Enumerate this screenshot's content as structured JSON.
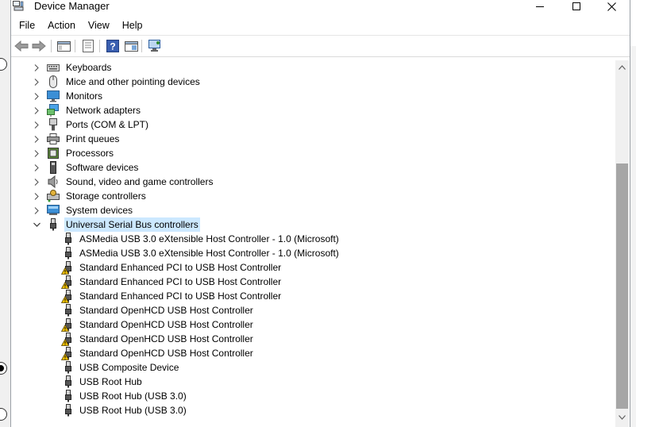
{
  "window": {
    "title": "Device Manager"
  },
  "menu": [
    "File",
    "Action",
    "View",
    "Help"
  ],
  "toolbar": [
    "back-icon",
    "forward-icon",
    "show-hide-console-tree-icon",
    "properties-icon",
    "help-icon",
    "update-driver-icon",
    "scan-hardware-icon"
  ],
  "categories": [
    {
      "label": "Keyboards",
      "icon": "keyboard-icon",
      "expanded": false
    },
    {
      "label": "Mice and other pointing devices",
      "icon": "mouse-icon",
      "expanded": false
    },
    {
      "label": "Monitors",
      "icon": "monitor-icon",
      "expanded": false
    },
    {
      "label": "Network adapters",
      "icon": "network-adapter-icon",
      "expanded": false
    },
    {
      "label": "Ports (COM & LPT)",
      "icon": "port-icon",
      "expanded": false
    },
    {
      "label": "Print queues",
      "icon": "printer-icon",
      "expanded": false
    },
    {
      "label": "Processors",
      "icon": "processor-icon",
      "expanded": false
    },
    {
      "label": "Software devices",
      "icon": "software-device-icon",
      "expanded": false
    },
    {
      "label": "Sound, video and game controllers",
      "icon": "speaker-icon",
      "expanded": false
    },
    {
      "label": "Storage controllers",
      "icon": "storage-controller-icon",
      "expanded": false
    },
    {
      "label": "System devices",
      "icon": "system-device-icon",
      "expanded": false
    },
    {
      "label": "Universal Serial Bus controllers",
      "icon": "usb-icon",
      "expanded": true,
      "selected": true
    }
  ],
  "usb_devices": [
    {
      "label": "ASMedia USB 3.0 eXtensible Host Controller - 1.0 (Microsoft)",
      "warning": false
    },
    {
      "label": "ASMedia USB 3.0 eXtensible Host Controller - 1.0 (Microsoft)",
      "warning": false
    },
    {
      "label": "Standard Enhanced PCI to USB Host Controller",
      "warning": true
    },
    {
      "label": "Standard Enhanced PCI to USB Host Controller",
      "warning": true
    },
    {
      "label": "Standard Enhanced PCI to USB Host Controller",
      "warning": true
    },
    {
      "label": "Standard OpenHCD USB Host Controller",
      "warning": false
    },
    {
      "label": "Standard OpenHCD USB Host Controller",
      "warning": true
    },
    {
      "label": "Standard OpenHCD USB Host Controller",
      "warning": true
    },
    {
      "label": "Standard OpenHCD USB Host Controller",
      "warning": true
    },
    {
      "label": "USB Composite Device",
      "warning": false
    },
    {
      "label": "USB Root Hub",
      "warning": false
    },
    {
      "label": "USB Root Hub (USB 3.0)",
      "warning": false
    },
    {
      "label": "USB Root Hub (USB 3.0)",
      "warning": false
    }
  ],
  "colors": {
    "selection": "#cce8ff",
    "scroll_thumb": "#a6a6a6",
    "warning": "#f2c200"
  }
}
